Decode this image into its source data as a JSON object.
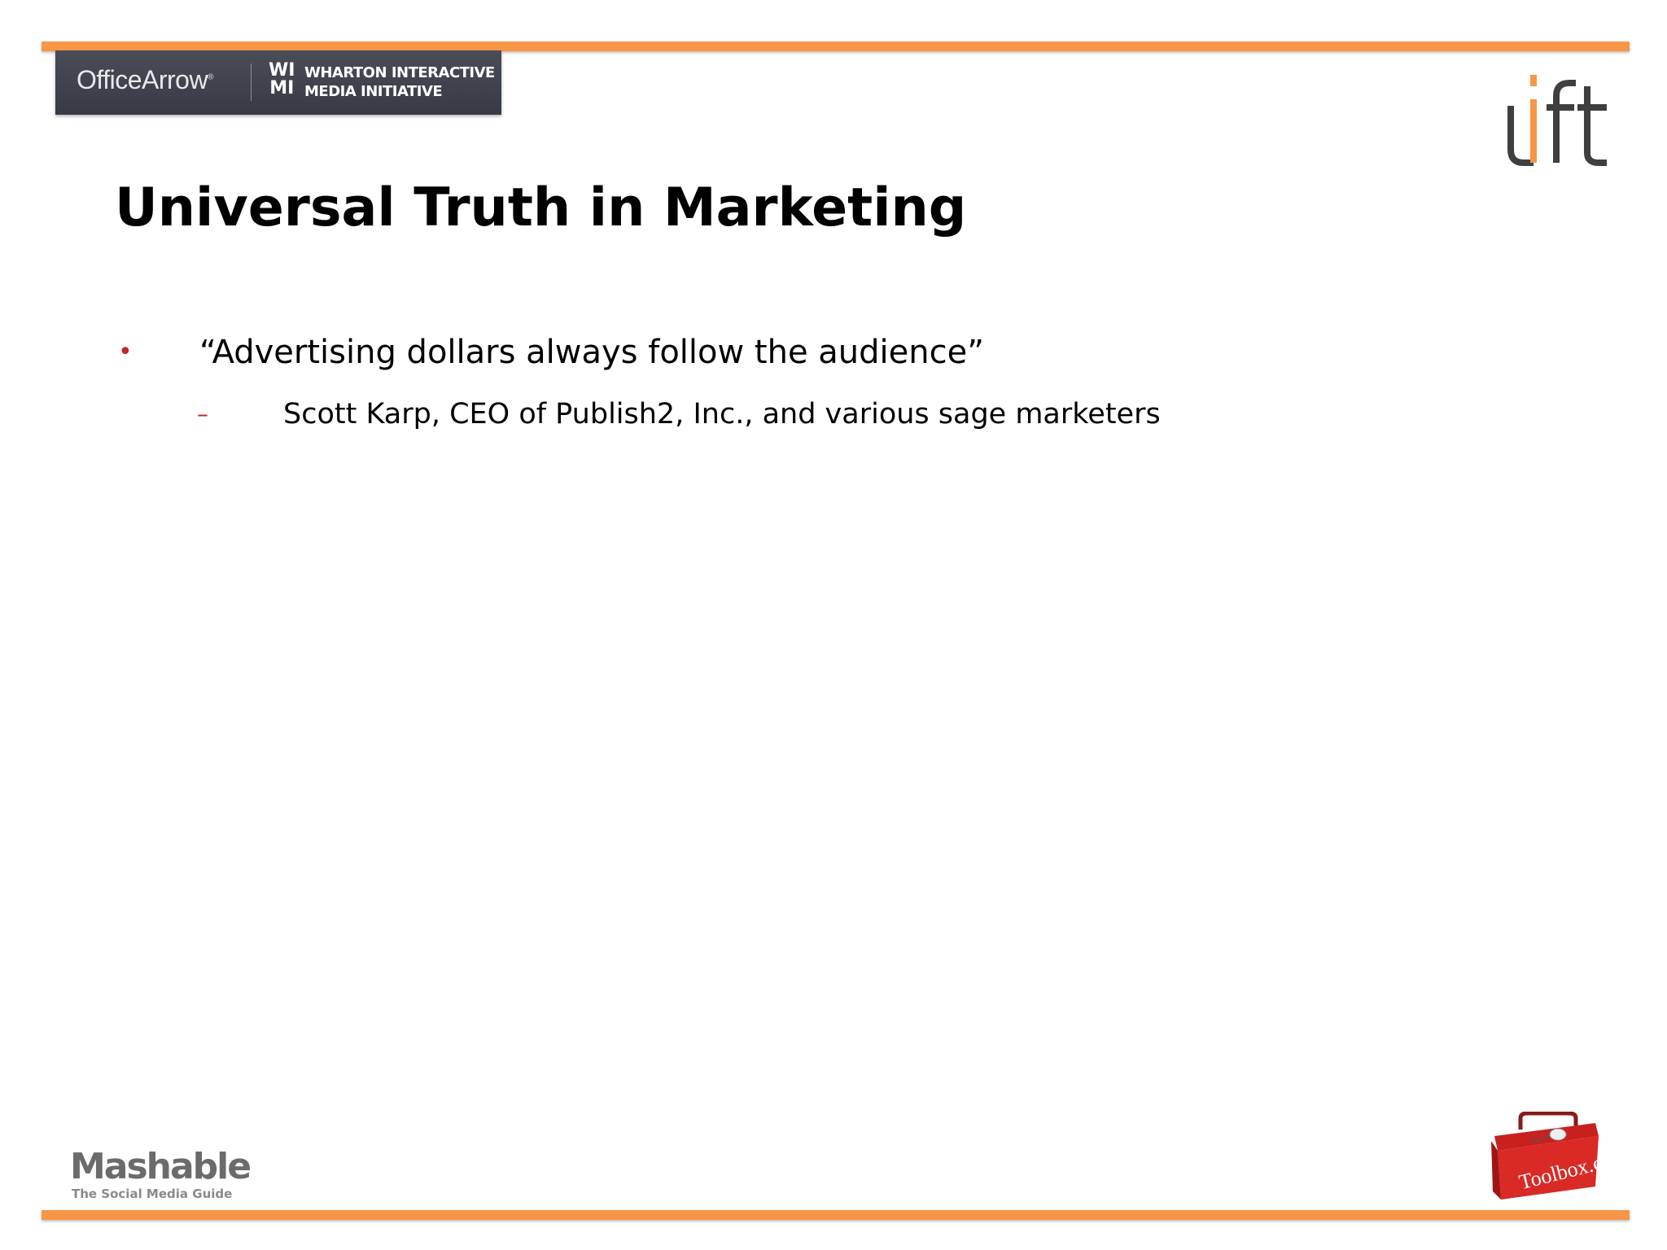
{
  "slide": {
    "title": "Universal Truth in Marketing",
    "bullets": [
      {
        "marker": "•",
        "text": "“Advertising dollars always follow the audience”",
        "sub": {
          "marker": "–",
          "text": "Scott Karp, CEO of Publish2, Inc., and various sage marketers"
        }
      }
    ]
  },
  "logos": {
    "officearrow": "OfficeArrow",
    "wimi_mark_top": "WI",
    "wimi_mark_bottom": "MI",
    "wimi_line1": "WHARTON INTERACTIVE",
    "wimi_line2": "MEDIA INITIATIVE",
    "uft": "uft",
    "mashable_name": "Mashable",
    "mashable_tagline": "The Social Media Guide",
    "toolbox": "Toolbox.com"
  },
  "colors": {
    "accent_bar": "#F79646",
    "bullet": "#C0262D",
    "banner": "#3E414B"
  }
}
